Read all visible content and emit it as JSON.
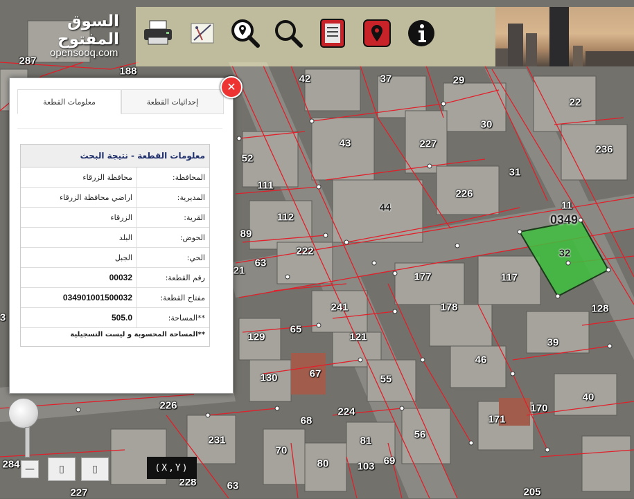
{
  "logo": {
    "arabic": "السوق المفتوح",
    "latin": "opensooq.com"
  },
  "panel": {
    "tabs": [
      "معلومات القطعة",
      "إحداثيات القطعة"
    ],
    "title": "معلومات القطعة - نتيجة البحث",
    "fields": [
      {
        "label": "المحافظة:",
        "value": "محافظة الزرقاء"
      },
      {
        "label": "المديرية:",
        "value": "اراضي محافظة الزرقاء"
      },
      {
        "label": "القرية:",
        "value": "الزرقاء"
      },
      {
        "label": "الحوض:",
        "value": "البلد"
      },
      {
        "label": "الحي:",
        "value": "الجبل"
      },
      {
        "label": "رقم القطعة:",
        "value": "00032"
      },
      {
        "label": "مفتاح القطعة:",
        "value": "034901001500032"
      },
      {
        "label": "**المساحة:",
        "value": "505.0"
      }
    ],
    "note": "**المساحة المحسوبة و ليست التسجيلية",
    "close_symbol": "✕"
  },
  "controls": {
    "xy_label": "(X,Y)",
    "zoom_out_symbol": "—",
    "button2_symbol": "▯",
    "button3_symbol": "▯"
  },
  "map": {
    "highlight_color": "#3fbf3f",
    "boundary_color": "#e0202a",
    "parcels": [
      {
        "id": "287"
      },
      {
        "id": "188"
      },
      {
        "id": "42"
      },
      {
        "id": "37"
      },
      {
        "id": "29"
      },
      {
        "id": "22"
      },
      {
        "id": "30"
      },
      {
        "id": "227"
      },
      {
        "id": "43"
      },
      {
        "id": "236"
      },
      {
        "id": "52"
      },
      {
        "id": "31"
      },
      {
        "id": "111"
      },
      {
        "id": "226"
      },
      {
        "id": "44"
      },
      {
        "id": "11"
      },
      {
        "id": "0349"
      },
      {
        "id": "112"
      },
      {
        "id": "89"
      },
      {
        "id": "32"
      },
      {
        "id": "222"
      },
      {
        "id": "63"
      },
      {
        "id": "21"
      },
      {
        "id": "177"
      },
      {
        "id": "117"
      },
      {
        "id": "241"
      },
      {
        "id": "178"
      },
      {
        "id": "128"
      },
      {
        "id": "65"
      },
      {
        "id": "121"
      },
      {
        "id": "129"
      },
      {
        "id": "39"
      },
      {
        "id": "46"
      },
      {
        "id": "67"
      },
      {
        "id": "55"
      },
      {
        "id": "130"
      },
      {
        "id": "226"
      },
      {
        "id": "40"
      },
      {
        "id": "224"
      },
      {
        "id": "170"
      },
      {
        "id": "68"
      },
      {
        "id": "171"
      },
      {
        "id": "56"
      },
      {
        "id": "231"
      },
      {
        "id": "81"
      },
      {
        "id": "70"
      },
      {
        "id": "80"
      },
      {
        "id": "69"
      },
      {
        "id": "103"
      },
      {
        "id": "284"
      },
      {
        "id": "228"
      },
      {
        "id": "63"
      },
      {
        "id": "227"
      },
      {
        "id": "205"
      },
      {
        "id": "3"
      }
    ]
  }
}
